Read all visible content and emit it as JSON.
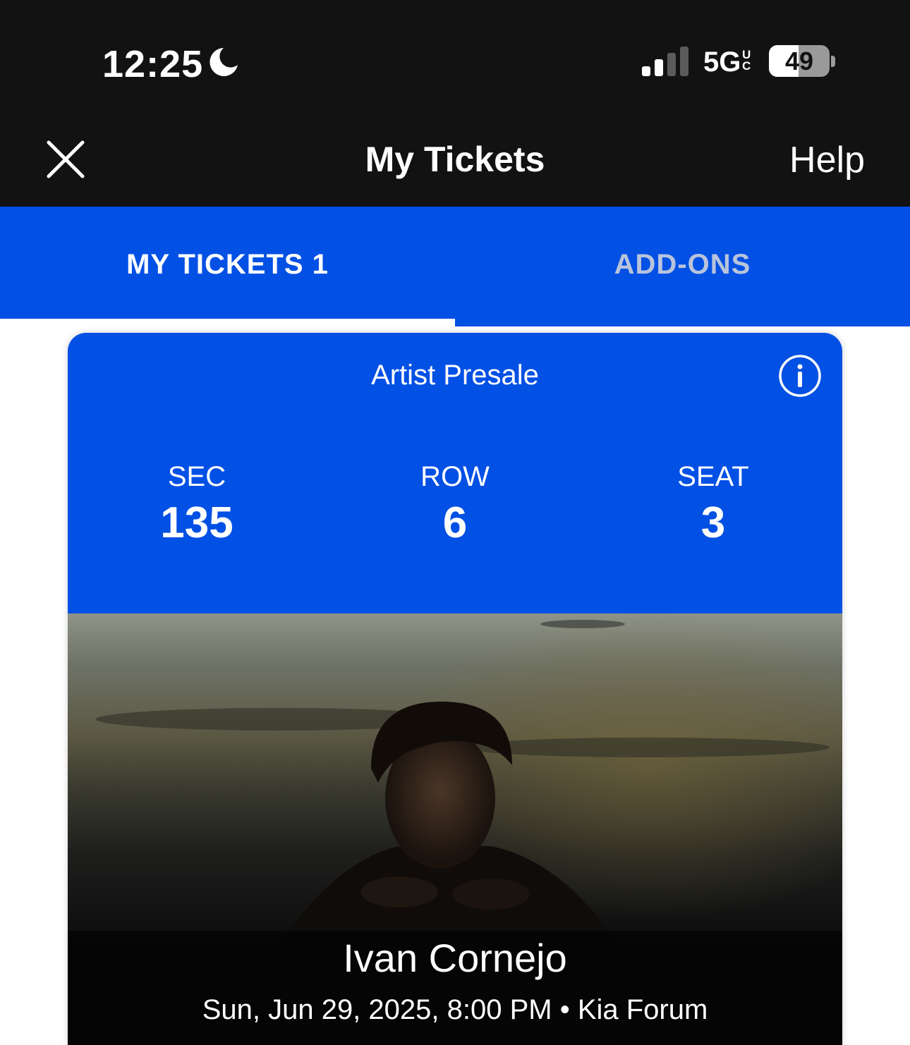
{
  "status_bar": {
    "time": "12:25",
    "network": "5G",
    "network_superscript_top": "U",
    "network_superscript_bottom": "C",
    "battery_level": 49,
    "battery_text": "49"
  },
  "nav": {
    "title": "My Tickets",
    "help_label": "Help"
  },
  "tabs": [
    {
      "label": "MY TICKETS 1",
      "active": true
    },
    {
      "label": "ADD-ONS",
      "active": false
    }
  ],
  "ticket": {
    "presale_label": "Artist Presale",
    "section_label": "SEC",
    "section_value": "135",
    "row_label": "ROW",
    "row_value": "6",
    "seat_label": "SEAT",
    "seat_value": "3",
    "artist": "Ivan Cornejo",
    "event_details": "Sun, Jun 29, 2025, 8:00 PM • Kia Forum"
  },
  "colors": {
    "brand_blue": "#0250e4",
    "header_black": "#121212",
    "inactive_tab": "#b8c4dc"
  },
  "icons": [
    "moon-icon",
    "signal-icon",
    "battery-icon",
    "close-icon",
    "info-icon"
  ]
}
